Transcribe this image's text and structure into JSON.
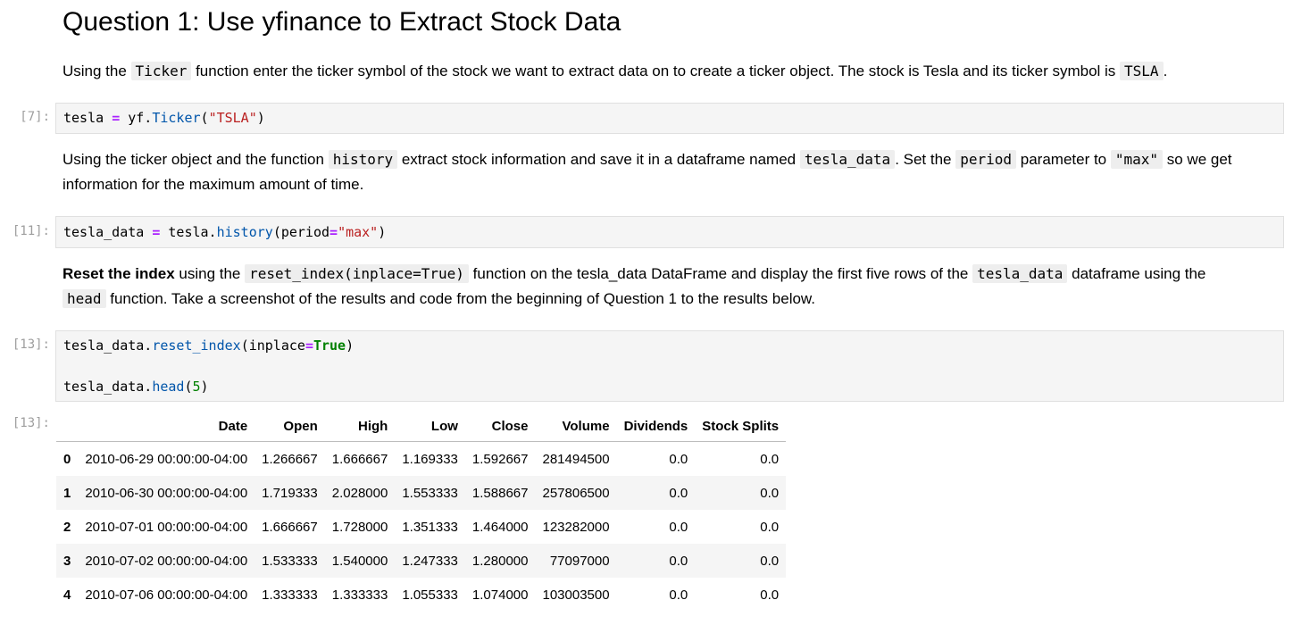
{
  "heading": "Question 1: Use yfinance to Extract Stock Data",
  "para1": {
    "t1": "Using the ",
    "code1": "Ticker",
    "t2": " function enter the ticker symbol of the stock we want to extract data on to create a ticker object. The stock is Tesla and its ticker symbol is ",
    "code2": "TSLA",
    "t3": "."
  },
  "cell1": {
    "prompt": "[7]:",
    "l1": {
      "a": "tesla ",
      "op": "=",
      "b": " yf.",
      "fn": "Ticker",
      "c": "(",
      "str": "\"TSLA\"",
      "d": ")"
    }
  },
  "para2": {
    "t1": "Using the ticker object and the function ",
    "code1": "history",
    "t2": " extract stock information and save it in a dataframe named ",
    "code2": "tesla_data",
    "t3": ". Set the ",
    "code3": "period",
    "t4": " parameter to ",
    "code4": "\"max\"",
    "t5": " so we get information for the maximum amount of time."
  },
  "cell2": {
    "prompt": "[11]:",
    "l1": {
      "a": "tesla_data ",
      "op": "=",
      "b": " tesla.",
      "fn": "history",
      "c": "(period",
      "op2": "=",
      "str": "\"max\"",
      "d": ")"
    }
  },
  "para3": {
    "bold": "Reset the index",
    "t1": " using the ",
    "code1": "reset_index(inplace=True)",
    "t2": " function on the tesla_data DataFrame and display the first five rows of the ",
    "code2": "tesla_data",
    "t3": " dataframe using the ",
    "code3": "head",
    "t4": " function. Take a screenshot of the results and code from the beginning of Question 1 to the results below."
  },
  "cell3": {
    "prompt": "[13]:",
    "l1": {
      "a": "tesla_data.",
      "fn": "reset_index",
      "b": "(inplace",
      "op": "=",
      "kw": "True",
      "c": ")"
    },
    "l2": {
      "a": "tesla_data.",
      "fn": "head",
      "b": "(",
      "num": "5",
      "c": ")"
    }
  },
  "output": {
    "prompt": "[13]:",
    "columns": [
      "",
      "Date",
      "Open",
      "High",
      "Low",
      "Close",
      "Volume",
      "Dividends",
      "Stock Splits"
    ],
    "rows": [
      [
        "0",
        "2010-06-29 00:00:00-04:00",
        "1.266667",
        "1.666667",
        "1.169333",
        "1.592667",
        "281494500",
        "0.0",
        "0.0"
      ],
      [
        "1",
        "2010-06-30 00:00:00-04:00",
        "1.719333",
        "2.028000",
        "1.553333",
        "1.588667",
        "257806500",
        "0.0",
        "0.0"
      ],
      [
        "2",
        "2010-07-01 00:00:00-04:00",
        "1.666667",
        "1.728000",
        "1.351333",
        "1.464000",
        "123282000",
        "0.0",
        "0.0"
      ],
      [
        "3",
        "2010-07-02 00:00:00-04:00",
        "1.533333",
        "1.540000",
        "1.247333",
        "1.280000",
        "77097000",
        "0.0",
        "0.0"
      ],
      [
        "4",
        "2010-07-06 00:00:00-04:00",
        "1.333333",
        "1.333333",
        "1.055333",
        "1.074000",
        "103003500",
        "0.0",
        "0.0"
      ]
    ]
  }
}
